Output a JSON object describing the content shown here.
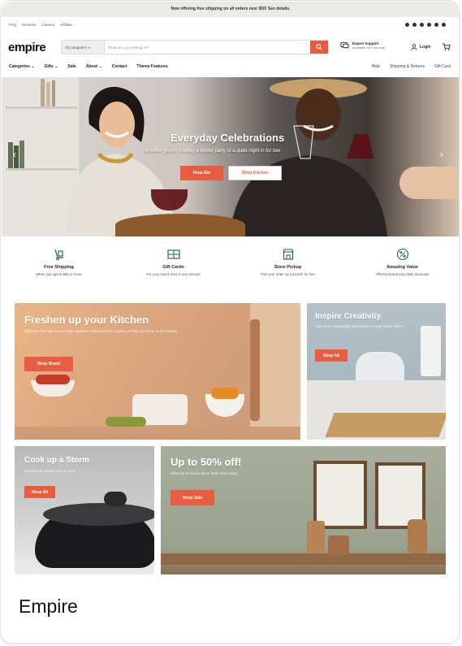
{
  "announcement": "Now offering free shipping on all orders over $50! See details.",
  "utility_links": [
    "FAQ",
    "Services",
    "Careers",
    "Affiliate"
  ],
  "brand": {
    "logo": "empire",
    "accent": "#e85c3f"
  },
  "search": {
    "category": "All categories",
    "placeholder": "What are you looking for?"
  },
  "support": {
    "title": "Expert Support",
    "subtitle": "Available 24/7 via chat"
  },
  "login_label": "Login",
  "nav": {
    "left": [
      "Categories",
      "Gifts",
      "Sale",
      "About",
      "Contact",
      "Theme Features"
    ],
    "right": [
      "Help",
      "Shipping & Returns",
      "Gift Card"
    ]
  },
  "hero": {
    "title": "Everyday Celebrations",
    "subtitle": "Whether you're hosting a dinner party or a quiet night in for two",
    "primary_cta": "Shop Bar",
    "secondary_cta": "Shop Kitchen"
  },
  "features": [
    {
      "title": "Free Shipping",
      "subtitle": "When you spend $50 or more",
      "icon": "dolly-icon"
    },
    {
      "title": "Gift Cards",
      "subtitle": "For your loved ones in any amount",
      "icon": "gift-card-icon"
    },
    {
      "title": "Store Pickup",
      "subtitle": "Pick your order up yourself, for free",
      "icon": "store-icon"
    },
    {
      "title": "Amazing Value",
      "subtitle": "Offering brand new daily discounts",
      "icon": "percent-badge-icon"
    }
  ],
  "tiles": {
    "kitchen": {
      "title": "Freshen up your Kitchen",
      "subtitle": "Welcome the new season with updated cookware from Cuisine to help you thrive in the kitchen",
      "cta": "Shop Brand"
    },
    "creativity": {
      "title": "Inspire Creativity",
      "subtitle": "Add some personality and warmth to your home office!",
      "cta": "Shop All"
    },
    "storm": {
      "title": "Cook up a Storm",
      "subtitle": "Browse our quality pots & pans",
      "cta": "Shop All"
    },
    "sale": {
      "title": "Up to 50% off!",
      "subtitle": "Save big on home decor selections today",
      "cta": "Shop Sale"
    }
  },
  "caption": "Empire"
}
